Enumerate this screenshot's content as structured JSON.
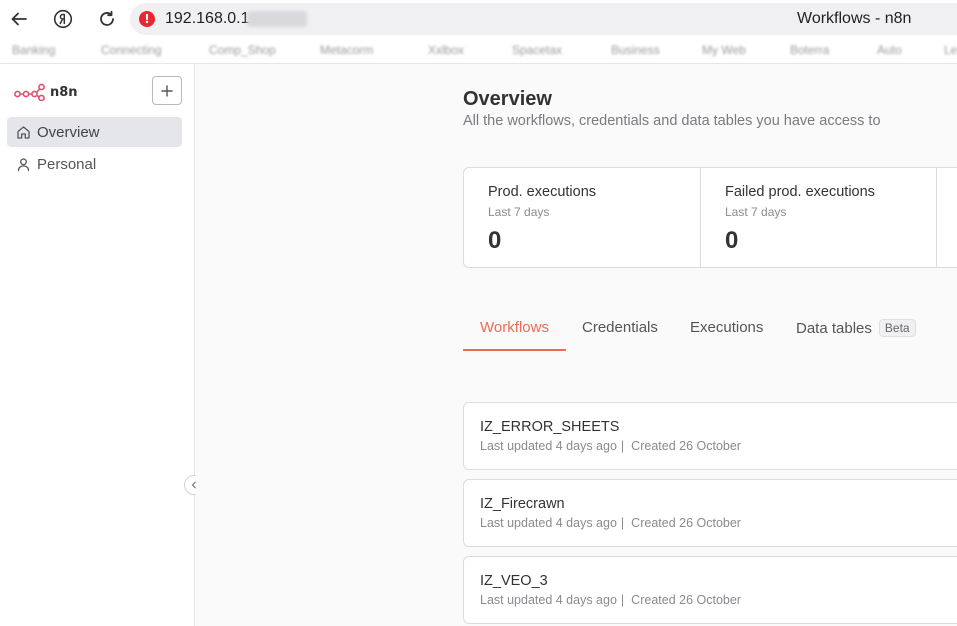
{
  "browser": {
    "url": "192.168.0.1",
    "page_title": "Workflows - n8n",
    "bookmarks": [
      "Banking",
      "Connecting",
      "Comp_Shop",
      "Metacorm",
      "Xxlbox",
      "Spacetax",
      "Business",
      "My Web",
      "Boterra",
      "Auto",
      "Le"
    ]
  },
  "sidebar": {
    "brand": "n8n",
    "items": [
      {
        "label": "Overview",
        "icon": "home-icon",
        "active": true
      },
      {
        "label": "Personal",
        "icon": "user-icon",
        "active": false
      }
    ]
  },
  "main": {
    "title": "Overview",
    "subtitle": "All the workflows, credentials and data tables you have access to",
    "stats": [
      {
        "label": "Prod. executions",
        "period": "Last 7 days",
        "value": "0"
      },
      {
        "label": "Failed prod. executions",
        "period": "Last 7 days",
        "value": "0"
      }
    ],
    "tabs": [
      {
        "label": "Workflows",
        "active": true
      },
      {
        "label": "Credentials",
        "active": false
      },
      {
        "label": "Executions",
        "active": false
      },
      {
        "label": "Data tables",
        "badge": "Beta",
        "active": false
      }
    ],
    "workflows": [
      {
        "name": "IZ_ERROR_SHEETS",
        "updated": "Last updated 4 days ago",
        "created": "Created 26 October"
      },
      {
        "name": "IZ_Firecrawn",
        "updated": "Last updated 4 days ago",
        "created": "Created 26 October"
      },
      {
        "name": "IZ_VEO_3",
        "updated": "Last updated 4 days ago",
        "created": "Created 26 October"
      }
    ]
  },
  "colors": {
    "accent": "#ee6a55",
    "brand_logo": "#ea4b71",
    "warning": "#e8262f"
  }
}
